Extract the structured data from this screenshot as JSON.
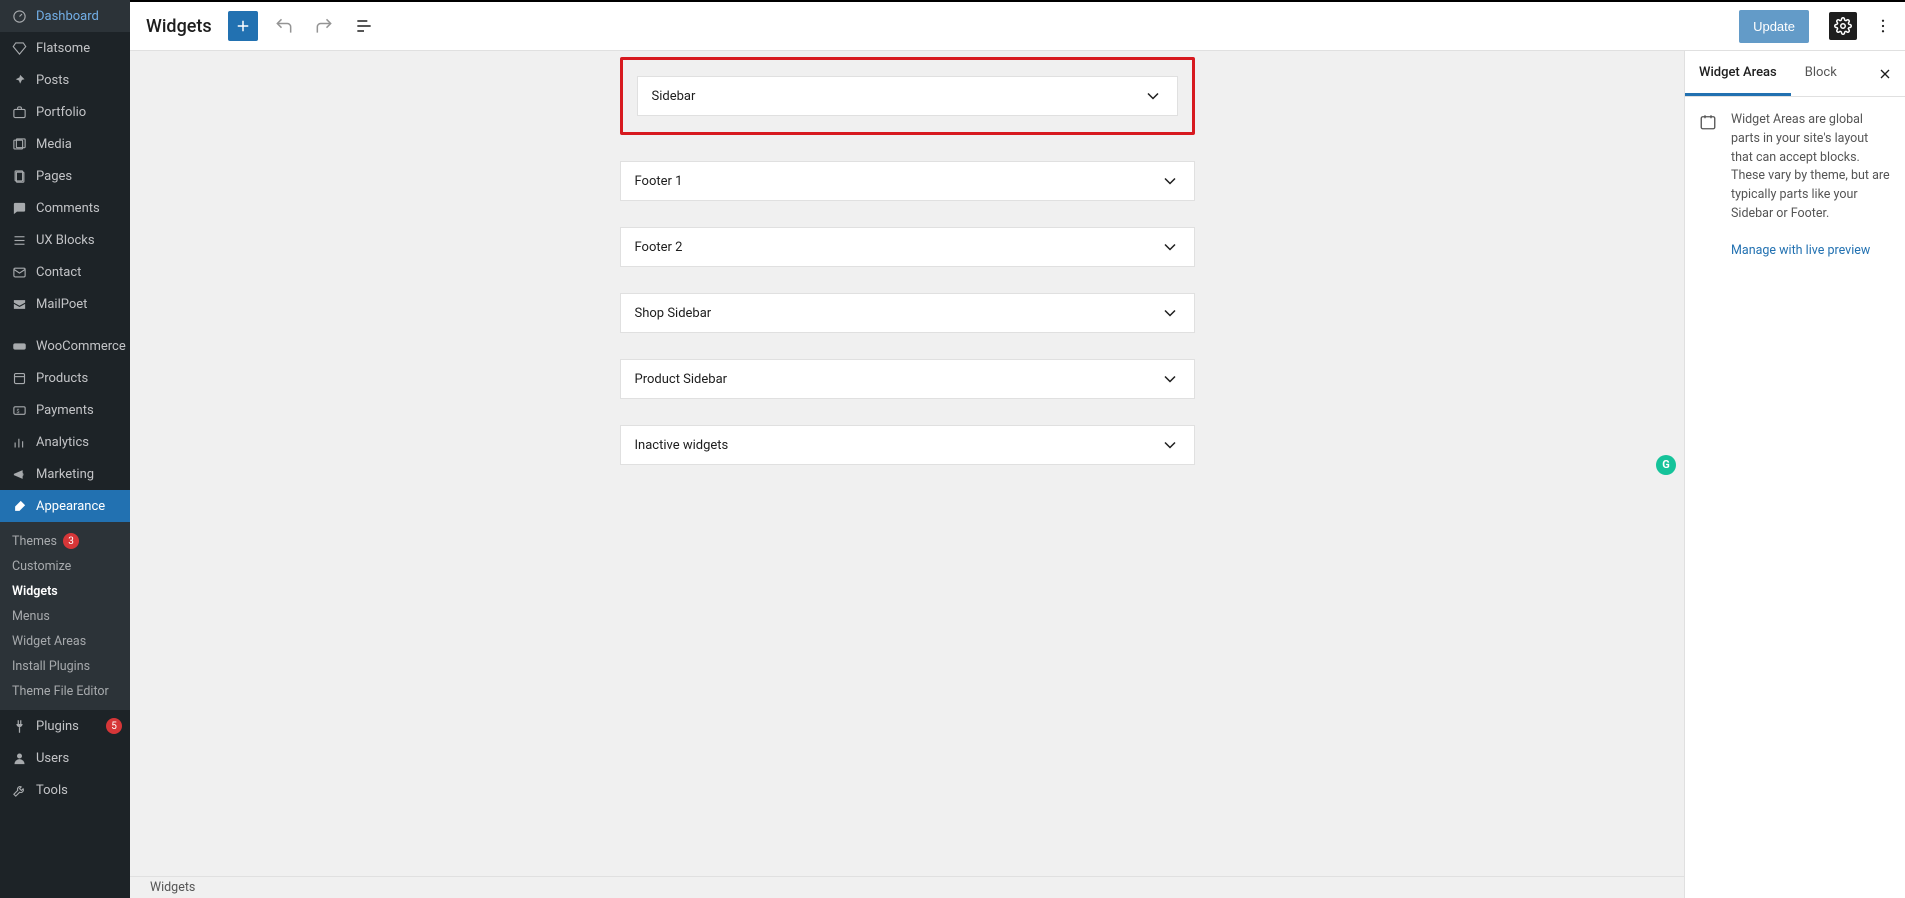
{
  "sidebar": {
    "items": [
      {
        "label": "Dashboard",
        "icon": "gauge"
      },
      {
        "label": "Flatsome",
        "icon": "gem"
      },
      {
        "label": "Posts",
        "icon": "pin"
      },
      {
        "label": "Portfolio",
        "icon": "briefcase"
      },
      {
        "label": "Media",
        "icon": "media"
      },
      {
        "label": "Pages",
        "icon": "pages"
      },
      {
        "label": "Comments",
        "icon": "comment"
      },
      {
        "label": "UX Blocks",
        "icon": "blocks"
      },
      {
        "label": "Contact",
        "icon": "envelope"
      },
      {
        "label": "MailPoet",
        "icon": "mailpoet"
      },
      {
        "label": "WooCommerce",
        "icon": "woo"
      },
      {
        "label": "Products",
        "icon": "product"
      },
      {
        "label": "Payments",
        "icon": "payments"
      },
      {
        "label": "Analytics",
        "icon": "analytics"
      },
      {
        "label": "Marketing",
        "icon": "megaphone"
      },
      {
        "label": "Appearance",
        "icon": "brush",
        "active": true
      },
      {
        "label": "Plugins",
        "icon": "plug",
        "badge": "5"
      },
      {
        "label": "Users",
        "icon": "user"
      },
      {
        "label": "Tools",
        "icon": "wrench"
      }
    ],
    "submenu": [
      {
        "label": "Themes",
        "badge": "3"
      },
      {
        "label": "Customize"
      },
      {
        "label": "Widgets",
        "current": true
      },
      {
        "label": "Menus"
      },
      {
        "label": "Widget Areas"
      },
      {
        "label": "Install Plugins"
      },
      {
        "label": "Theme File Editor"
      }
    ]
  },
  "topbar": {
    "title": "Widgets",
    "update_label": "Update"
  },
  "widgets": {
    "areas": [
      {
        "label": "Sidebar",
        "highlight": true
      },
      {
        "label": "Footer 1"
      },
      {
        "label": "Footer 2"
      },
      {
        "label": "Shop Sidebar"
      },
      {
        "label": "Product Sidebar"
      },
      {
        "label": "Inactive widgets"
      }
    ]
  },
  "footer": {
    "breadcrumb": "Widgets"
  },
  "inspector": {
    "tabs": [
      "Widget Areas",
      "Block"
    ],
    "active_tab": 0,
    "description": "Widget Areas are global parts in your site's layout that can accept blocks. These vary by theme, but are typically parts like your Sidebar or Footer.",
    "link": "Manage with live preview"
  }
}
